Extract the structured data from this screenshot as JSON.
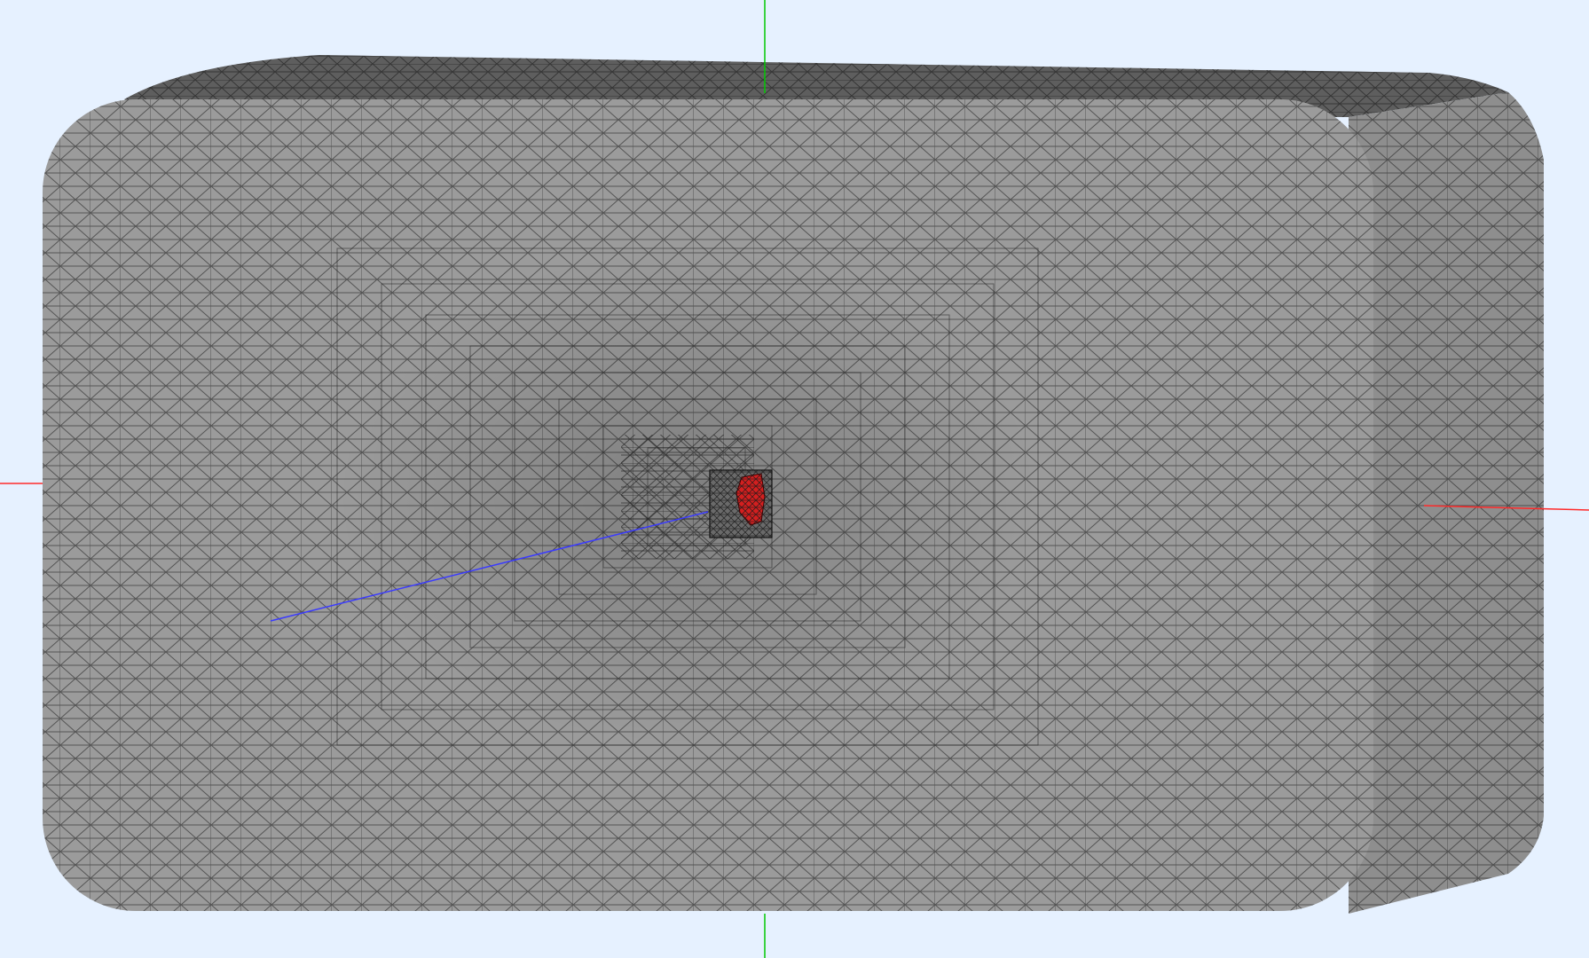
{
  "viewport": {
    "background_color": "#e6f1ff",
    "projection": "perspective"
  },
  "mesh": {
    "element_type": "tetrahedral",
    "display_mode": "surface-with-edges",
    "surface_color": "#9b9b9b",
    "shaded_color": "#5e5e5e",
    "edge_color": "#1a1a1a",
    "edge_opacity": 0.55
  },
  "highlight": {
    "color": "#d41f1f",
    "edge_color": "#3a0000"
  },
  "axes": {
    "x_color": "#ff2a2a",
    "y_color": "#00c800",
    "z_color": "#3a3aff"
  },
  "icons": [
    "x-axis-icon",
    "y-axis-icon",
    "z-axis-icon"
  ]
}
